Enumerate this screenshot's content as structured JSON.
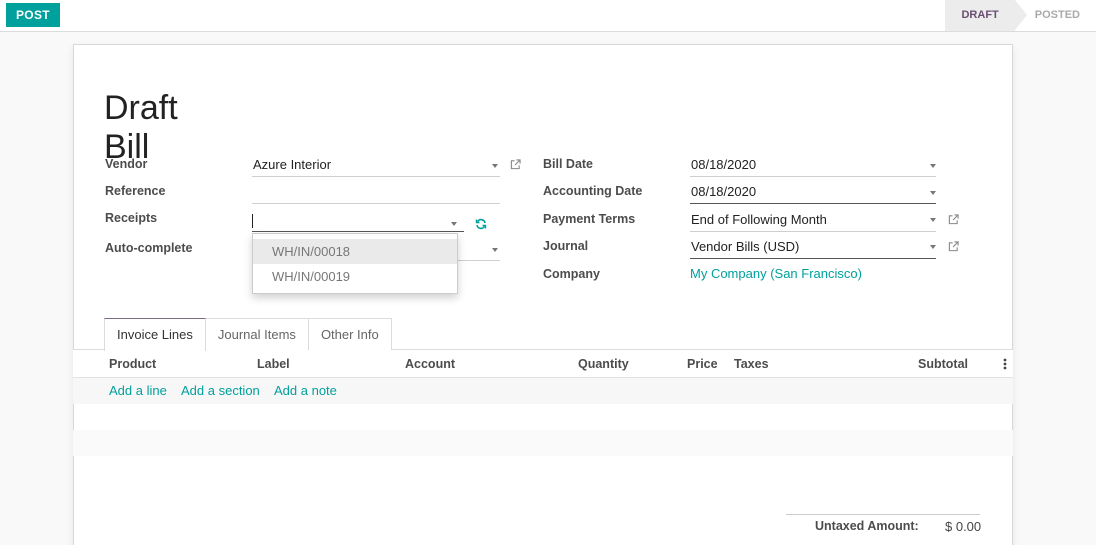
{
  "toolbar": {
    "post_label": "POST"
  },
  "statusbar": {
    "draft": "DRAFT",
    "posted": "POSTED"
  },
  "title": "Draft Bill",
  "left_fields": {
    "vendor_label": "Vendor",
    "vendor_value": "Azure Interior",
    "reference_label": "Reference",
    "reference_value": "",
    "receipts_label": "Receipts",
    "receipts_value": "",
    "autocomplete_label": "Auto-complete",
    "autocomplete_value": ""
  },
  "right_fields": {
    "bill_date_label": "Bill Date",
    "bill_date_value": "08/18/2020",
    "accounting_date_label": "Accounting Date",
    "accounting_date_value": "08/18/2020",
    "payment_terms_label": "Payment Terms",
    "payment_terms_value": "End of Following Month",
    "journal_label": "Journal",
    "journal_value": "Vendor Bills (USD)",
    "company_label": "Company",
    "company_value": "My Company (San Francisco)"
  },
  "receipts_dropdown": [
    "WH/IN/00018",
    "WH/IN/00019"
  ],
  "tabs": [
    "Invoice Lines",
    "Journal Items",
    "Other Info"
  ],
  "table": {
    "columns": [
      "Product",
      "Label",
      "Account",
      "Quantity",
      "Price",
      "Taxes",
      "Subtotal"
    ],
    "add_line": "Add a line",
    "add_section": "Add a section",
    "add_note": "Add a note"
  },
  "totals": {
    "untaxed_label": "Untaxed Amount:",
    "untaxed_value": "$ 0.00"
  },
  "colors": {
    "accent": "#00a09d",
    "brand": "#7c6b82"
  }
}
